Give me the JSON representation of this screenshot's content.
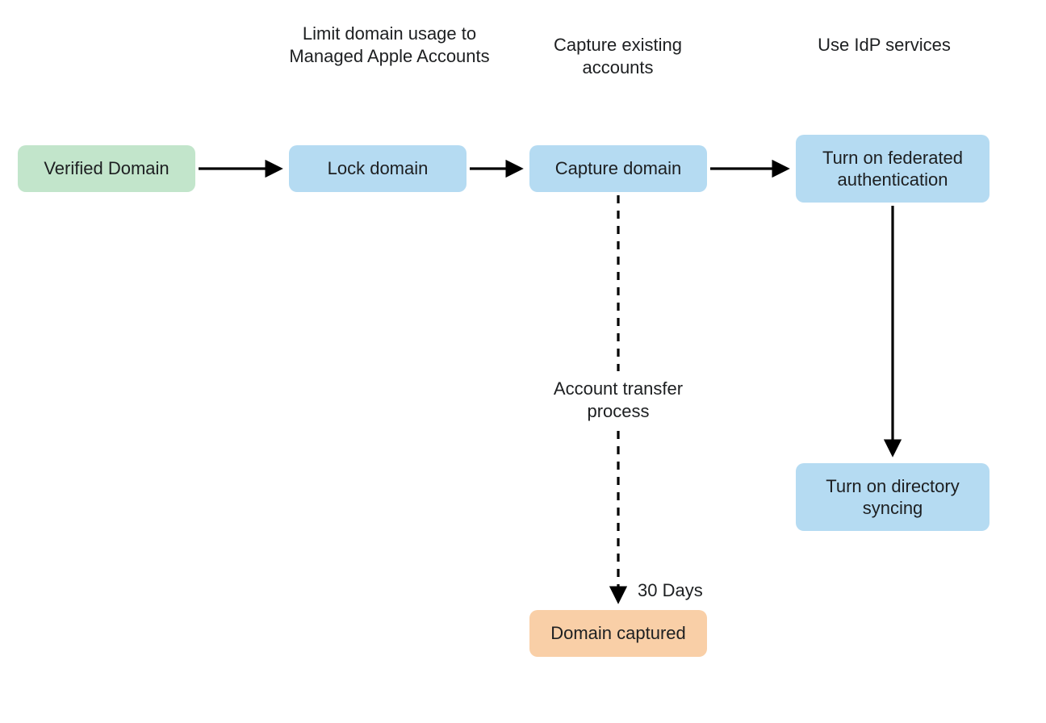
{
  "nodes": {
    "verified_domain": "Verified Domain",
    "lock_domain": "Lock domain",
    "capture_domain": "Capture domain",
    "federated_auth": "Turn on federated authentication",
    "directory_sync": "Turn on directory syncing",
    "domain_captured": "Domain captured"
  },
  "labels": {
    "limit_usage": "Limit domain usage to Managed Apple Accounts",
    "capture_existing": "Capture existing accounts",
    "use_idp": "Use IdP services",
    "account_transfer": "Account transfer process",
    "thirty_days": "30 Days"
  },
  "colors": {
    "green": "#c2e5cb",
    "blue": "#b5dbf2",
    "orange": "#f9cfa7",
    "text": "#1d1f21",
    "arrow": "#000000"
  },
  "chart_data": {
    "type": "flow",
    "description": "Domain management flow for Managed Apple Accounts",
    "nodes": [
      {
        "id": "verified_domain",
        "label": "Verified Domain",
        "color": "green"
      },
      {
        "id": "lock_domain",
        "label": "Lock domain",
        "color": "blue",
        "header": "Limit domain usage to Managed Apple Accounts"
      },
      {
        "id": "capture_domain",
        "label": "Capture domain",
        "color": "blue",
        "header": "Capture existing accounts"
      },
      {
        "id": "federated_auth",
        "label": "Turn on federated authentication",
        "color": "blue",
        "header": "Use IdP services"
      },
      {
        "id": "directory_sync",
        "label": "Turn on directory syncing",
        "color": "blue"
      },
      {
        "id": "domain_captured",
        "label": "Domain captured",
        "color": "orange"
      }
    ],
    "edges": [
      {
        "from": "verified_domain",
        "to": "lock_domain",
        "style": "solid"
      },
      {
        "from": "lock_domain",
        "to": "capture_domain",
        "style": "solid"
      },
      {
        "from": "capture_domain",
        "to": "federated_auth",
        "style": "solid"
      },
      {
        "from": "federated_auth",
        "to": "directory_sync",
        "style": "solid",
        "direction": "down"
      },
      {
        "from": "capture_domain",
        "to": "domain_captured",
        "style": "dashed",
        "direction": "down",
        "label_mid": "Account transfer process",
        "label_end": "30 Days"
      }
    ]
  }
}
